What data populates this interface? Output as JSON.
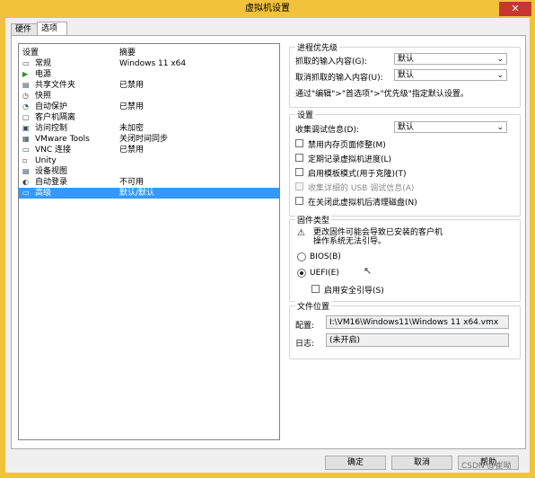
{
  "window": {
    "title": "虚拟机设置",
    "close": "✕"
  },
  "tabs": [
    "硬件",
    "选项"
  ],
  "list": {
    "col_setting": "设置",
    "col_summary": "摘要",
    "items": [
      {
        "name": "常规",
        "summary": "Windows 11 x64",
        "icon": "general-icon"
      },
      {
        "name": "电源",
        "summary": "",
        "icon": "power-icon"
      },
      {
        "name": "共享文件夹",
        "summary": "已禁用",
        "icon": "shared-folder-icon"
      },
      {
        "name": "快照",
        "summary": "",
        "icon": "snapshot-icon"
      },
      {
        "name": "自动保护",
        "summary": "已禁用",
        "icon": "autoprotect-icon"
      },
      {
        "name": "客户机隔离",
        "summary": "",
        "icon": "isolation-icon"
      },
      {
        "name": "访问控制",
        "summary": "未加密",
        "icon": "access-control-icon"
      },
      {
        "name": "VMware Tools",
        "summary": "关闭时间同步",
        "icon": "vmware-tools-icon"
      },
      {
        "name": "VNC 连接",
        "summary": "已禁用",
        "icon": "vnc-icon"
      },
      {
        "name": "Unity",
        "summary": "",
        "icon": "unity-icon"
      },
      {
        "name": "设备视图",
        "summary": "",
        "icon": "device-view-icon"
      },
      {
        "name": "自动登录",
        "summary": "不可用",
        "icon": "autologin-icon"
      },
      {
        "name": "高级",
        "summary": "默认/默认",
        "icon": "advanced-icon"
      }
    ]
  },
  "priority": {
    "title": "进程优先级",
    "grabbed_label": "抓取的输入内容(G):",
    "grabbed_value": "默认",
    "ungrabbed_label": "取消抓取的输入内容(U):",
    "ungrabbed_value": "默认",
    "hint": "通过\"编辑\">\"首选项\">\"优先级\"指定默认设置。"
  },
  "settings": {
    "title": "设置",
    "debug_label": "收集调试信息(D):",
    "debug_value": "默认",
    "checks": [
      {
        "label": "禁用内存页面修整(M)",
        "disabled": false
      },
      {
        "label": "定期记录虚拟机进度(L)",
        "disabled": false
      },
      {
        "label": "启用模板模式(用于克隆)(T)",
        "disabled": false
      },
      {
        "label": "收集详细的 USB 调试信息(A)",
        "disabled": true
      },
      {
        "label": "在关闭此虚拟机后清理磁盘(N)",
        "disabled": false
      }
    ]
  },
  "firmware": {
    "title": "固件类型",
    "warning": "更改固件可能会导致已安装的客户机\n操作系统无法引导。",
    "bios": "BIOS(B)",
    "uefi": "UEFI(E)",
    "secure_boot": "启用安全引导(S)"
  },
  "file_location": {
    "title": "文件位置",
    "config_label": "配置:",
    "config_value": "I:\\VM16\\Windows11\\Windows 11 x64.vmx",
    "log_label": "日志:",
    "log_value": "(未开启)"
  },
  "buttons": {
    "ok": "确定",
    "cancel": "取消",
    "help": "帮助"
  },
  "watermark": "CSDN @崔呦"
}
